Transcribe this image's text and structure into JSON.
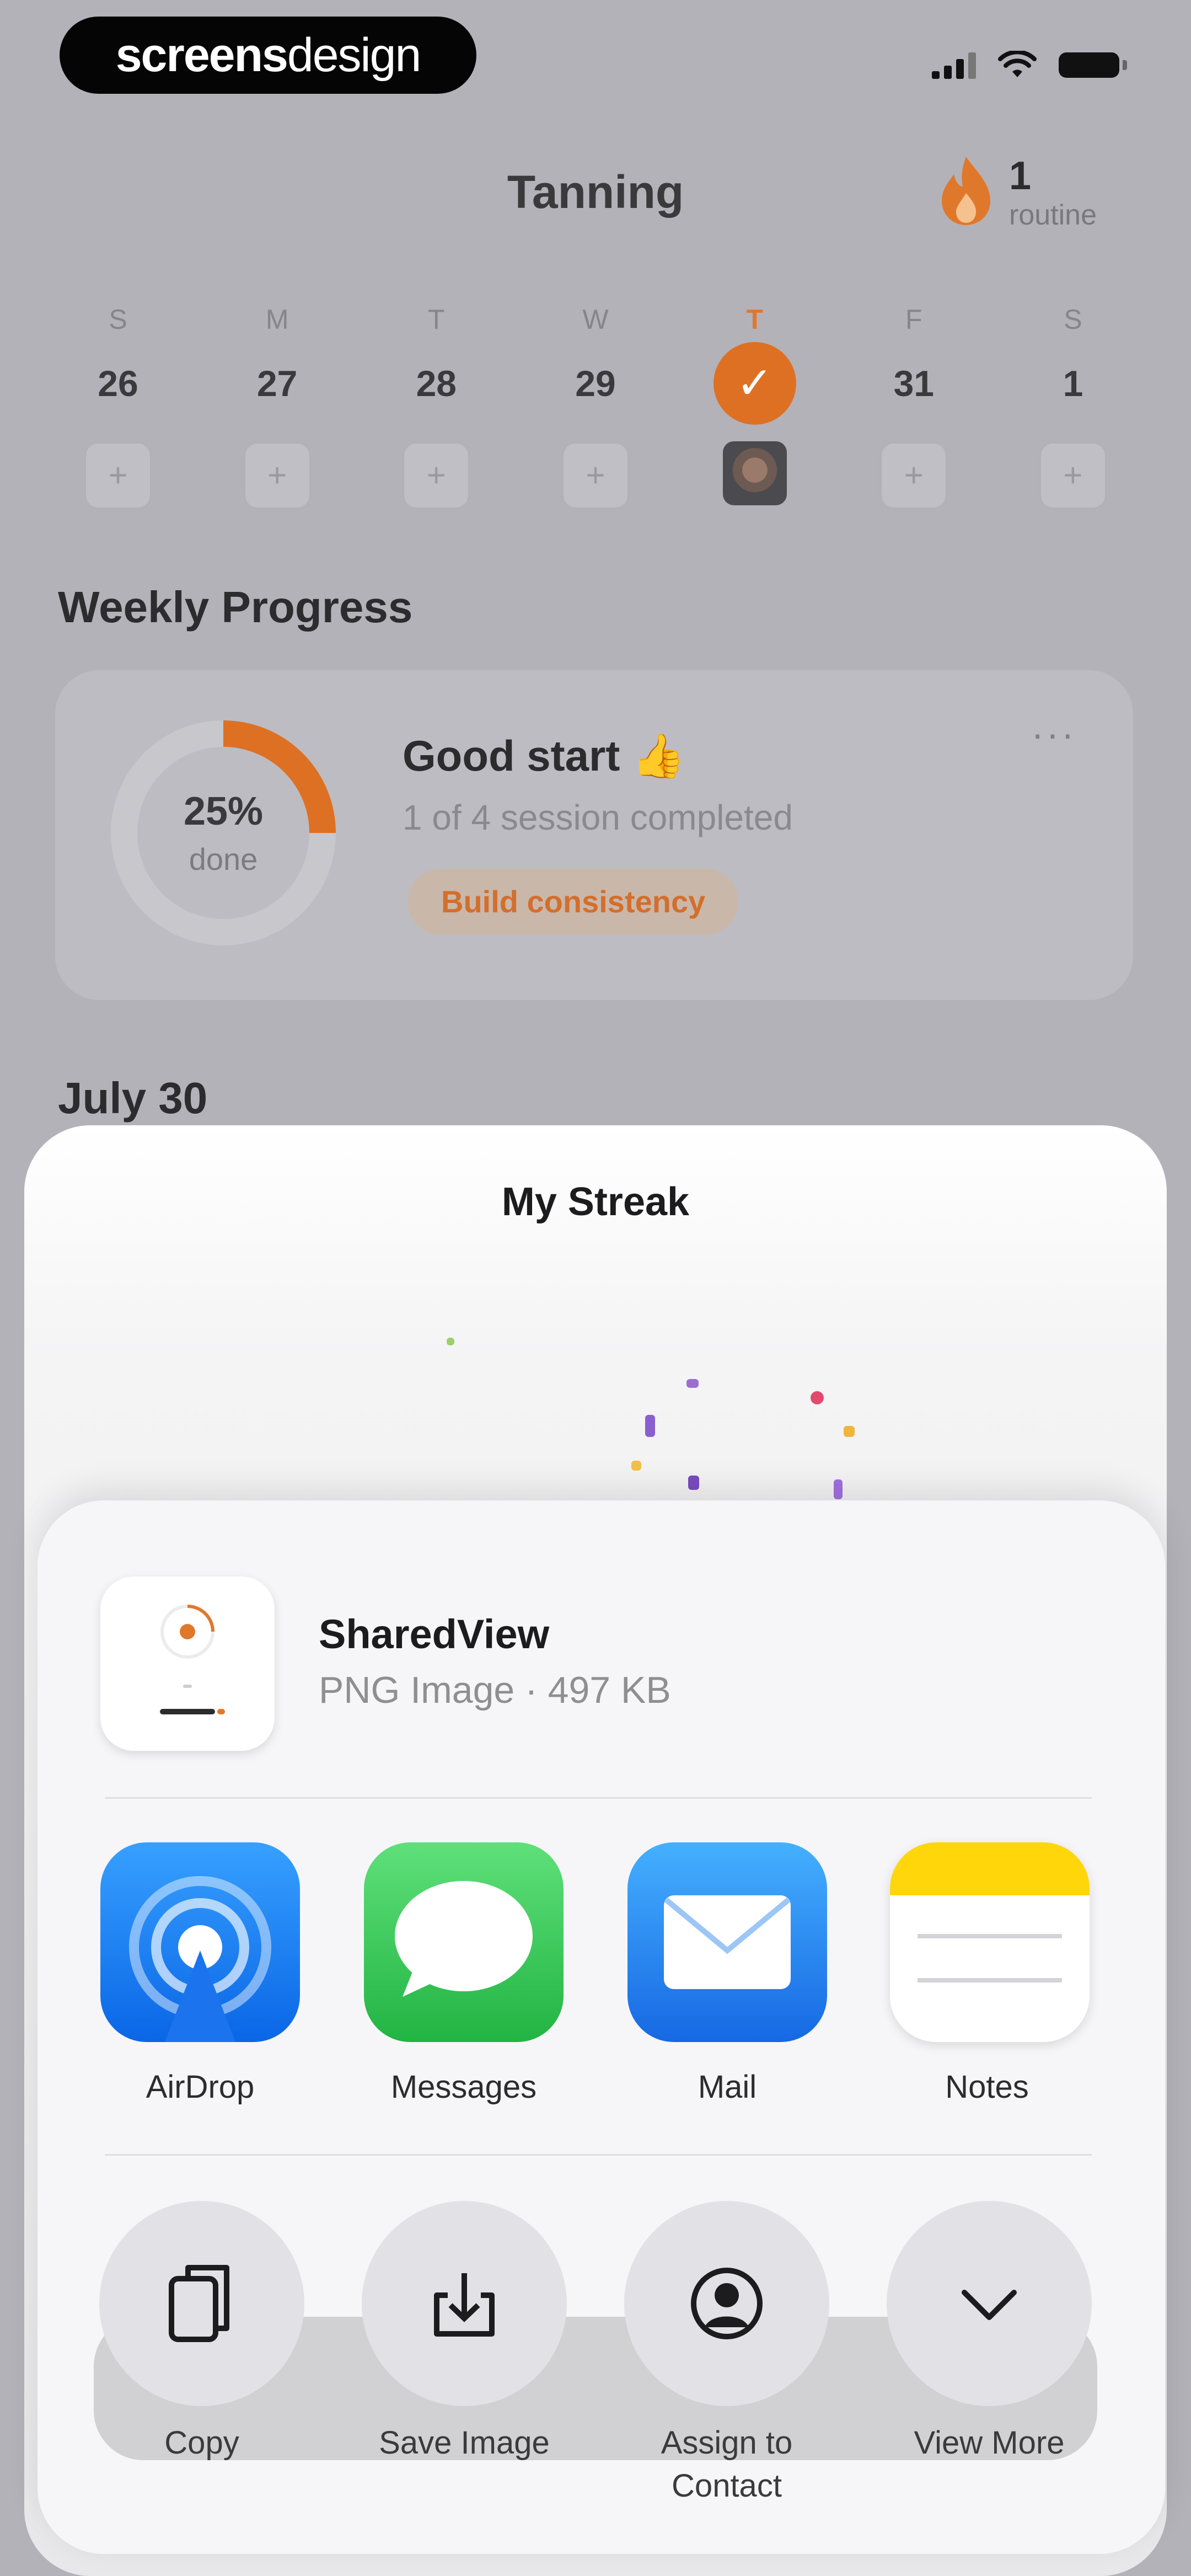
{
  "watermark": {
    "bold": "screens",
    "light": "design"
  },
  "header": {
    "title": "Tanning",
    "streak_count": "1",
    "streak_label": "routine"
  },
  "week": {
    "days": [
      {
        "letter": "S",
        "num": "26"
      },
      {
        "letter": "M",
        "num": "27"
      },
      {
        "letter": "T",
        "num": "28"
      },
      {
        "letter": "W",
        "num": "29"
      },
      {
        "letter": "T",
        "num": "✓"
      },
      {
        "letter": "F",
        "num": "31"
      },
      {
        "letter": "S",
        "num": "1"
      }
    ],
    "slot_plus": "+"
  },
  "weekly_progress": {
    "title": "Weekly Progress",
    "percent_label": "25%",
    "percent_value": 0.25,
    "done_label": "done",
    "heading": "Good start 👍",
    "subtext": "1 of 4 session completed",
    "badge": "Build consistency",
    "more": "···"
  },
  "date_heading": "July 30",
  "streak_sheet": {
    "title": "My Streak"
  },
  "share_sheet": {
    "file_name": "SharedView",
    "file_info": "PNG Image · 497 KB",
    "apps": [
      {
        "label": "AirDrop",
        "icon": "airdrop-icon"
      },
      {
        "label": "Messages",
        "icon": "messages-icon"
      },
      {
        "label": "Mail",
        "icon": "mail-icon"
      },
      {
        "label": "Notes",
        "icon": "notes-icon"
      }
    ],
    "actions": [
      {
        "label": "Copy",
        "icon": "copy-icon"
      },
      {
        "label": "Save Image",
        "icon": "save-image-icon"
      },
      {
        "label": "Assign to Contact",
        "icon": "contact-icon"
      },
      {
        "label": "View More",
        "icon": "chevron-down-icon"
      }
    ]
  },
  "colors": {
    "accent": "#de7024",
    "airdrop": "#1f7cf2",
    "messages": "#34c759",
    "mail": "#2f8cf0",
    "notes": "#ffd60a"
  }
}
